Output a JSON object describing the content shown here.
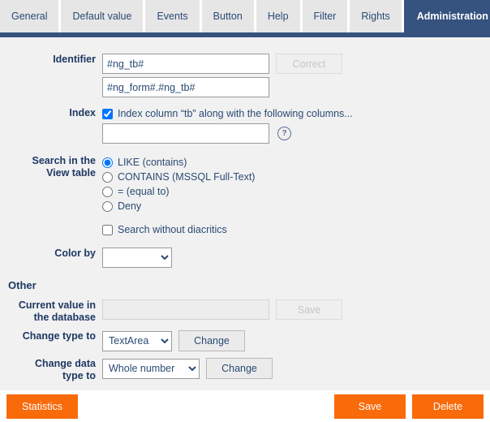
{
  "tabs": [
    {
      "label": "General",
      "active": false
    },
    {
      "label": "Default value",
      "active": false
    },
    {
      "label": "Events",
      "active": false
    },
    {
      "label": "Button",
      "active": false
    },
    {
      "label": "Help",
      "active": false
    },
    {
      "label": "Filter",
      "active": false
    },
    {
      "label": "Rights",
      "active": false
    },
    {
      "label": "Administration",
      "active": true
    }
  ],
  "identifier": {
    "label": "Identifier",
    "value_primary": "#ng_tb#",
    "value_secondary": "#ng_form#.#ng_tb#",
    "correct_button": "Correct"
  },
  "index": {
    "label": "Index",
    "checkbox_label": "Index column “tb” along with the following columns...",
    "checked": true,
    "columns_value": "",
    "help_icon": "question-mark-icon",
    "help_glyph": "?"
  },
  "search": {
    "label_line1": "Search in the",
    "label_line2": "View table",
    "options": [
      {
        "label": "LIKE (contains)",
        "selected": true
      },
      {
        "label": "CONTAINS (MSSQL Full-Text)",
        "selected": false
      },
      {
        "label": "= (equal to)",
        "selected": false
      },
      {
        "label": "Deny",
        "selected": false
      }
    ],
    "diacritics_label": "Search without diacritics",
    "diacritics_checked": false
  },
  "color_by": {
    "label": "Color by",
    "selected": "",
    "options": [
      ""
    ]
  },
  "other": {
    "title": "Other",
    "current_value": {
      "label_line1": "Current value in",
      "label_line2": "the database",
      "value": "",
      "save_button": "Save"
    },
    "change_type": {
      "label": "Change type to",
      "selected": "TextArea",
      "options": [
        "TextArea"
      ],
      "button": "Change"
    },
    "change_data_type": {
      "label_line1": "Change data",
      "label_line2": "type to",
      "selected": "Whole number",
      "options": [
        "Whole number"
      ],
      "button": "Change"
    }
  },
  "footer": {
    "statistics": "Statistics",
    "save": "Save",
    "delete": "Delete"
  },
  "colors": {
    "accent_orange": "#f96a0b",
    "active_tab_blue": "#36527f",
    "label_blue": "#1f3864",
    "form_bg": "#f1f1f1"
  }
}
